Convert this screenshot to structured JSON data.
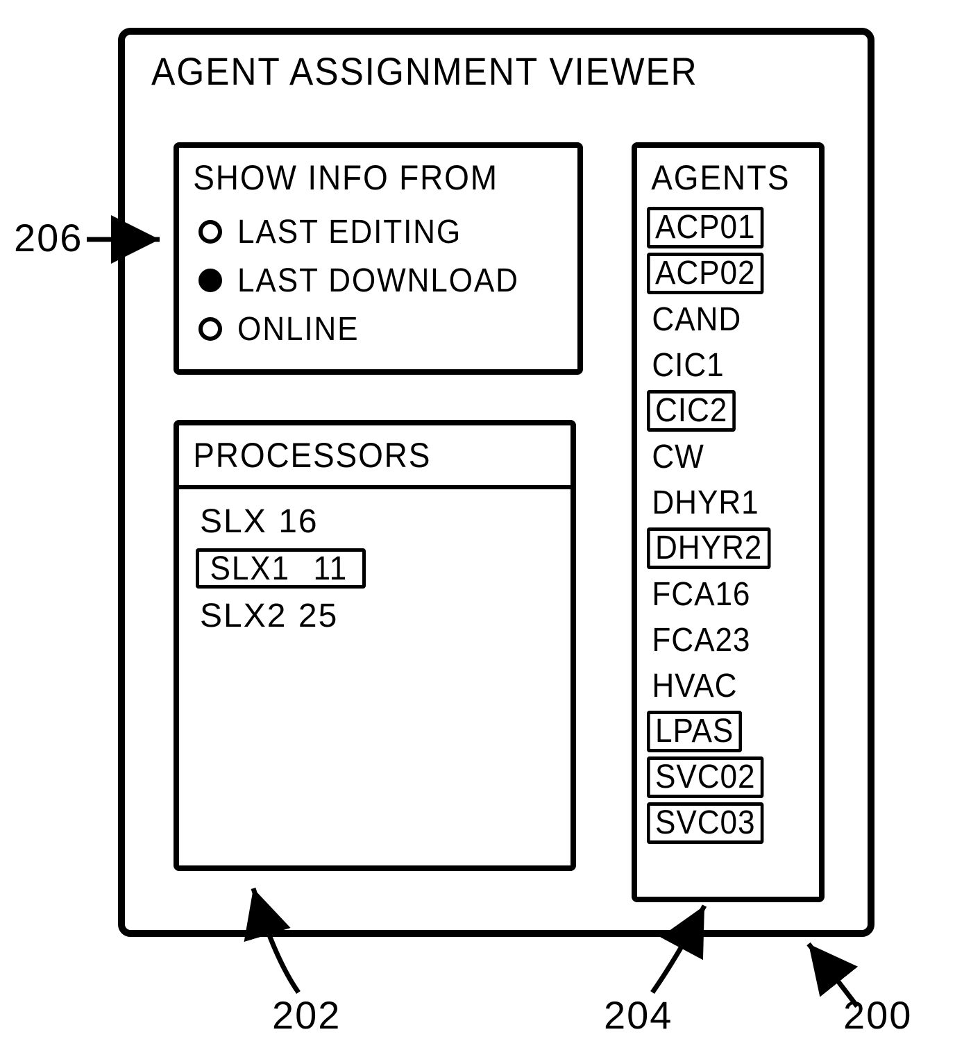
{
  "window": {
    "title": "AGENT ASSIGNMENT VIEWER"
  },
  "info_panel": {
    "title": "SHOW INFO FROM",
    "options": [
      {
        "label": "LAST EDITING",
        "selected": false
      },
      {
        "label": "LAST DOWNLOAD",
        "selected": true
      },
      {
        "label": "ONLINE",
        "selected": false
      }
    ]
  },
  "processors_panel": {
    "title": "PROCESSORS",
    "rows": [
      {
        "name": "SLX",
        "value": "16",
        "boxed": false
      },
      {
        "name": "SLX1",
        "value": "11",
        "boxed": true
      },
      {
        "name": "SLX2",
        "value": "25",
        "boxed": false
      }
    ]
  },
  "agents_panel": {
    "title": "AGENTS",
    "items": [
      {
        "label": "ACP01",
        "boxed": true
      },
      {
        "label": "ACP02",
        "boxed": true
      },
      {
        "label": "CAND",
        "boxed": false
      },
      {
        "label": "CIC1",
        "boxed": false
      },
      {
        "label": "CIC2",
        "boxed": true
      },
      {
        "label": "CW",
        "boxed": false
      },
      {
        "label": "DHYR1",
        "boxed": false
      },
      {
        "label": "DHYR2",
        "boxed": true
      },
      {
        "label": "FCA16",
        "boxed": false
      },
      {
        "label": "FCA23",
        "boxed": false
      },
      {
        "label": "HVAC",
        "boxed": false
      },
      {
        "label": "LPAS",
        "boxed": true
      },
      {
        "label": "SVC02",
        "boxed": true
      },
      {
        "label": "SVC03",
        "boxed": true
      }
    ]
  },
  "refs": {
    "r200": "200",
    "r202": "202",
    "r204": "204",
    "r206": "206"
  }
}
